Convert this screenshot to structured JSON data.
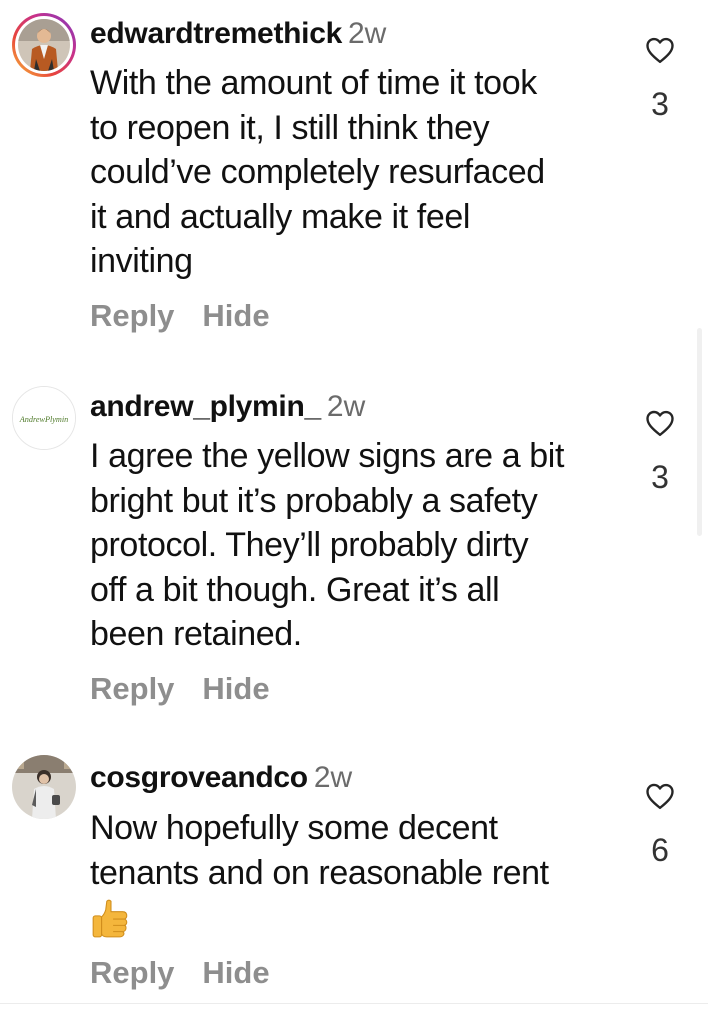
{
  "comments": [
    {
      "username": "edwardtremethick",
      "time": "2w",
      "lines": [
        "With the amount of time it took",
        "to reopen it, I still think they",
        "could’ve completely resurfaced",
        "it and actually make it feel",
        "inviting"
      ],
      "like_count": "3",
      "reply_label": "Reply",
      "hide_label": "Hide",
      "avatar_icon": "profile-photo-icon"
    },
    {
      "username": "andrew_plymin_",
      "time": "2w",
      "lines": [
        "I agree the yellow signs are a bit",
        "bright but it’s probably a safety",
        "protocol. They’ll  probably dirty",
        "off a bit though. Great it’s all",
        "been retained."
      ],
      "like_count": "3",
      "reply_label": "Reply",
      "hide_label": "Hide",
      "avatar_logo_text": "AndrewPlymin"
    },
    {
      "username": "cosgroveandco",
      "time": "2w",
      "lines": [
        "Now hopefully some decent",
        "tenants and on reasonable rent"
      ],
      "emoji": "thumbs-up-emoji",
      "like_count": "6",
      "reply_label": "Reply",
      "hide_label": "Hide",
      "avatar_icon": "profile-photo-icon"
    }
  ],
  "icons": {
    "like": "heart-outline-icon"
  },
  "colors": {
    "text": "#111111",
    "muted": "#8e8e8e",
    "timestamp": "#6b6b6b",
    "logo_green": "#4f7a2a",
    "emoji_yellow": "#f4b63c"
  }
}
